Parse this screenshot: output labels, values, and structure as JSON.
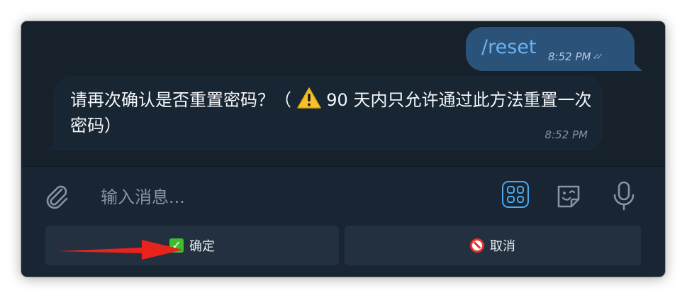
{
  "messages": {
    "outgoing": {
      "text": "/reset",
      "time": "8:52 PM",
      "read_marks": "✓✓"
    },
    "incoming": {
      "text_before_icon": "请再次确认是否重置密码？（",
      "icon": "warning-icon",
      "text_after_icon": " 90 天内只允许通过此方法重置一次密码）",
      "time": "8:52 PM"
    }
  },
  "composer": {
    "placeholder": "输入消息...",
    "value": ""
  },
  "keyboard": {
    "confirm_label": "确定",
    "confirm_icon": "check-mark-button-icon",
    "cancel_label": "取消",
    "cancel_icon": "no-entry-icon"
  },
  "colors": {
    "window_bg": "#1a2533",
    "outgoing_bubble": "#2b5278",
    "incoming_bubble": "#182533",
    "link_blue": "#6ab3f3",
    "keyboard_button": "#22303f",
    "annotation_arrow": "#e8221c"
  }
}
